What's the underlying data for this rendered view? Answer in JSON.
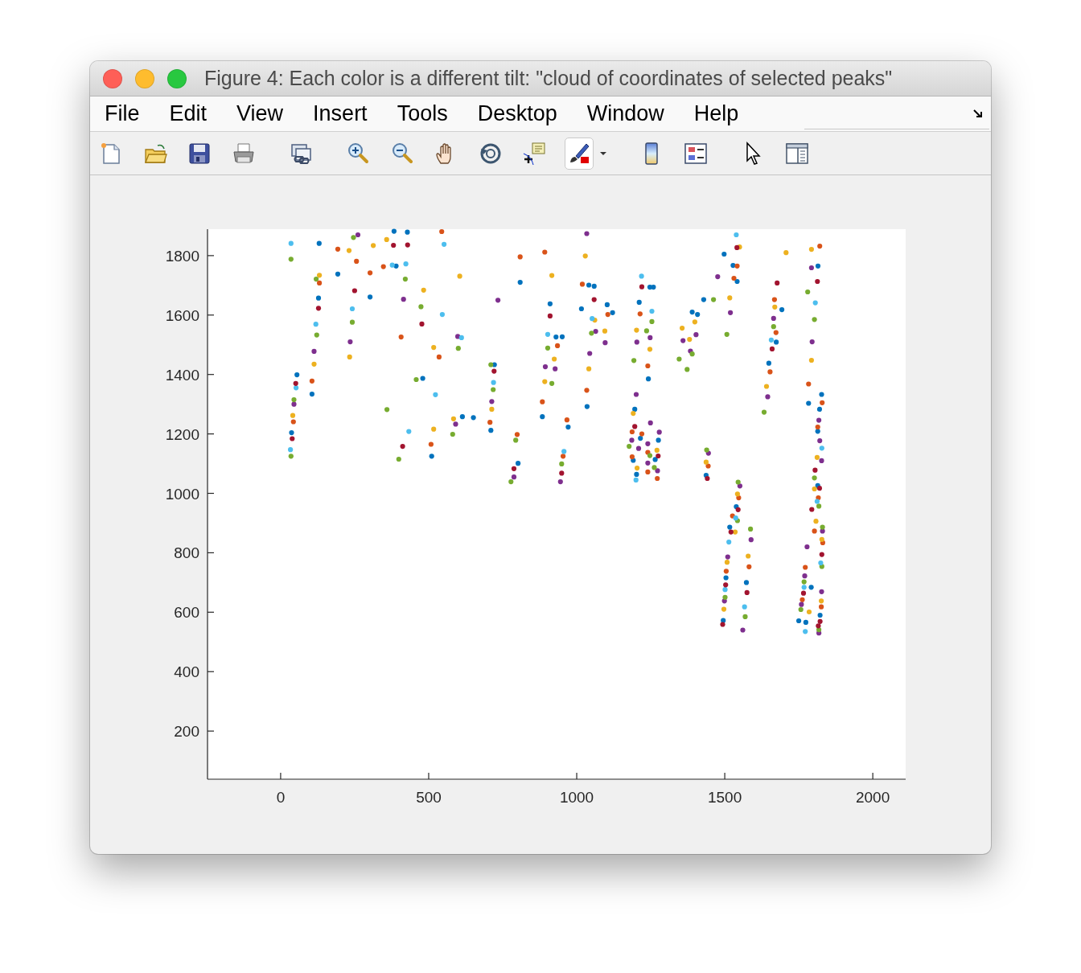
{
  "window": {
    "title": "Figure 4: Each color is a different tilt: \"cloud of coordinates of selected peaks\""
  },
  "menu": [
    "File",
    "Edit",
    "View",
    "Insert",
    "Tools",
    "Desktop",
    "Window",
    "Help"
  ],
  "toolbar": {
    "groups": [
      [
        {
          "kind": "new",
          "pressed": false
        },
        {
          "kind": "open",
          "pressed": false
        },
        {
          "kind": "save",
          "pressed": false
        },
        {
          "kind": "print",
          "pressed": false
        }
      ],
      [
        {
          "kind": "link",
          "pressed": false
        }
      ],
      [
        {
          "kind": "zoom-in",
          "pressed": false
        },
        {
          "kind": "zoom-out",
          "pressed": false
        },
        {
          "kind": "pan",
          "pressed": false
        },
        {
          "kind": "rotate",
          "pressed": false
        },
        {
          "kind": "datatip",
          "pressed": false
        },
        {
          "kind": "brush",
          "pressed": true
        },
        {
          "kind": "dropdown",
          "pressed": false
        }
      ],
      [
        {
          "kind": "colorbar",
          "pressed": false
        },
        {
          "kind": "legend",
          "pressed": false
        }
      ],
      [
        {
          "kind": "pointer",
          "pressed": false
        },
        {
          "kind": "property",
          "pressed": false
        }
      ]
    ]
  },
  "axes": {
    "chart_data": {
      "type": "scatter",
      "xlim": [
        -247,
        2111
      ],
      "ylim": [
        38,
        1889
      ],
      "xticks": [
        0,
        500,
        1000,
        1500,
        2000
      ],
      "yticks": [
        200,
        400,
        600,
        800,
        1000,
        1200,
        1400,
        1600,
        1800
      ],
      "series": [
        {
          "color": "#0072bd",
          "x": [
            37,
            55,
            130,
            128,
            193,
            106,
            302,
            614,
            510,
            428,
            383,
            480,
            651,
            390,
            809,
            1016,
            1035,
            884,
            971,
            1242,
            1649,
            1783,
            1815,
            1437,
            910,
            951,
            930,
            1041,
            1059,
            1103,
            1121,
            1211,
            1247,
            1259,
            1408,
            1390,
            1429,
            1498,
            1542,
            1528,
            1674,
            1693,
            710,
            722,
            802,
            1196,
            1191,
            1202,
            1215,
            1276,
            1265,
            1827,
            1820,
            1814,
            1539,
            1517,
            1573,
            1504,
            1495,
            1814,
            1792,
            1822,
            1750,
            1774
          ],
          "values": [
            1204,
            1399,
            1841,
            1657,
            1738,
            1334,
            1661,
            1258,
            1125,
            1879,
            1882,
            1387,
            1255,
            1765,
            1710,
            1621,
            1292,
            1258,
            1223,
            1385,
            1438,
            1303,
            1765,
            1061,
            1638,
            1527,
            1526,
            1701,
            1697,
            1635,
            1608,
            1643,
            1694,
            1694,
            1602,
            1610,
            1652,
            1805,
            1713,
            1767,
            1509,
            1618,
            1212,
            1433,
            1101,
            1283,
            1111,
            1064,
            1185,
            1179,
            1114,
            1333,
            1283,
            1209,
            955,
            886,
            700,
            716,
            572,
            1026,
            684,
            590,
            571,
            566
          ]
        },
        {
          "color": "#d95319",
          "x": [
            43,
            131,
            193,
            256,
            106,
            347,
            302,
            508,
            535,
            544,
            407,
            809,
            1034,
            884,
            967,
            1240,
            1653,
            1783,
            1821,
            1444,
            1272,
            892,
            935,
            1019,
            1105,
            1214,
            1531,
            1542,
            1668,
            1673,
            707,
            799,
            954,
            1187,
            1187,
            1220,
            1240,
            1240,
            1829,
            1814,
            1547,
            1526,
            1582,
            1505,
            1816,
            1803,
            1831,
            1772,
            1826,
            1762
          ],
          "values": [
            1241,
            1708,
            1822,
            1781,
            1378,
            1763,
            1742,
            1165,
            1459,
            1881,
            1526,
            1796,
            1347,
            1308,
            1247,
            1429,
            1409,
            1368,
            1832,
            1092,
            1050,
            1812,
            1497,
            1704,
            1602,
            1604,
            1724,
            1765,
            1652,
            1541,
            1239,
            1198,
            1125,
            1207,
            1123,
            1200,
            1138,
            1072,
            1305,
            1223,
            985,
            924,
            753,
            738,
            985,
            873,
            834,
            751,
            618,
            642
          ]
        },
        {
          "color": "#edb120",
          "x": [
            41,
            131,
            231,
            233,
            113,
            313,
            584,
            517,
            483,
            605,
            358,
            517,
            892,
            1095,
            1247,
            1517,
            1641,
            1793,
            1793,
            1437,
            1061,
            1041,
            916,
            924,
            1029,
            1202,
            1356,
            1381,
            1399,
            1550,
            1669,
            1707,
            713,
            1191,
            1204,
            1271,
            1812,
            1803,
            1543,
            1535,
            1579,
            1508,
            1497,
            1808,
            1828,
            1826,
            1785
          ],
          "values": [
            1262,
            1734,
            1817,
            1459,
            1435,
            1834,
            1251,
            1216,
            1684,
            1731,
            1854,
            1491,
            1376,
            1546,
            1485,
            1658,
            1360,
            1448,
            1821,
            1105,
            1583,
            1419,
            1733,
            1452,
            1799,
            1549,
            1556,
            1518,
            1577,
            1829,
            1627,
            1810,
            1283,
            1269,
            1085,
            1145,
            1121,
            1015,
            998,
            870,
            789,
            768,
            610,
            906,
            845,
            638,
            601
          ]
        },
        {
          "color": "#7e2f8e",
          "x": [
            45,
            235,
            113,
            261,
            591,
            598,
            415,
            894,
            1096,
            1203,
            1519,
            1645,
            1795,
            1793,
            1445,
            1551,
            1064,
            1044,
            927,
            1034,
            1248,
            1359,
            1403,
            1384,
            1476,
            1665,
            734,
            713,
            788,
            945,
            1201,
            1186,
            1209,
            1249,
            1240,
            1240,
            1279,
            1273,
            1818,
            1821,
            1827,
            1589,
            1561,
            1510,
            1499,
            1830,
            1778,
            1770,
            1827,
            1818,
            1759
          ],
          "values": [
            1300,
            1510,
            1478,
            1870,
            1233,
            1528,
            1653,
            1426,
            1507,
            1509,
            1608,
            1325,
            1510,
            1759,
            1135,
            1025,
            1545,
            1471,
            1419,
            1874,
            1524,
            1514,
            1534,
            1479,
            1729,
            1589,
            1650,
            1309,
            1055,
            1039,
            1333,
            1179,
            1151,
            1237,
            1167,
            1102,
            1206,
            1076,
            1246,
            1177,
            1110,
            844,
            540,
            786,
            638,
            873,
            820,
            722,
            669,
            530,
            626
          ]
        },
        {
          "color": "#77ac30",
          "x": [
            35,
            35,
            45,
            120,
            242,
            122,
            246,
            581,
            359,
            474,
            458,
            600,
            421,
            399,
            902,
            1193,
            1346,
            1373,
            1507,
            1633,
            1803,
            1780,
            778,
            1439,
            1545,
            1050,
            916,
            1236,
            1254,
            1390,
            1462,
            1665,
            718,
            710,
            794,
            949,
            1177,
            1247,
            1262,
            1803,
            1543,
            1587,
            1569,
            1501,
            1818,
            1830,
            1828,
            1768,
            1818,
            1757
          ],
          "values": [
            1788,
            1125,
            1315,
            1721,
            1576,
            1533,
            1861,
            1199,
            1282,
            1628,
            1383,
            1488,
            1721,
            1115,
            1489,
            1447,
            1452,
            1417,
            1535,
            1273,
            1585,
            1678,
            1039,
            1146,
            1038,
            1539,
            1370,
            1547,
            1578,
            1469,
            1652,
            1561,
            1349,
            1433,
            1179,
            1099,
            1158,
            1127,
            1087,
            1052,
            908,
            880,
            585,
            650,
            957,
            886,
            754,
            702,
            541,
            609
          ]
        },
        {
          "color": "#4dbeee",
          "x": [
            35,
            33,
            52,
            242,
            119,
            377,
            423,
            523,
            611,
            546,
            552,
            433,
            902,
            1806,
            1052,
            1219,
            1254,
            1539,
            1657,
            719,
            957,
            1200,
            1828,
            1537,
            1514,
            1567,
            1501,
            1812,
            1824,
            1768,
            1772
          ],
          "values": [
            1841,
            1147,
            1355,
            1621,
            1569,
            1768,
            1772,
            1332,
            1524,
            1602,
            1838,
            1208,
            1535,
            1641,
            1588,
            1731,
            1613,
            1870,
            1516,
            1373,
            1141,
            1045,
            1152,
            917,
            836,
            618,
            676,
            973,
            766,
            684,
            535
          ]
        },
        {
          "color": "#a2142f",
          "x": [
            39,
            51,
            128,
            250,
            429,
            477,
            381,
            412,
            1813,
            1441,
            910,
            1059,
            1220,
            1541,
            1677,
            1660,
            721,
            788,
            949,
            1196,
            1275,
            1805,
            1820,
            1545,
            1521,
            1575,
            1503,
            1493,
            1794,
            1828,
            1822,
            1816,
            1766
          ],
          "values": [
            1184,
            1370,
            1623,
            1682,
            1836,
            1570,
            1835,
            1158,
            1713,
            1050,
            1597,
            1652,
            1695,
            1827,
            1708,
            1486,
            1411,
            1083,
            1068,
            1225,
            1126,
            1078,
            1017,
            945,
            870,
            666,
            692,
            559,
            946,
            794,
            569,
            554,
            664
          ]
        }
      ]
    }
  }
}
